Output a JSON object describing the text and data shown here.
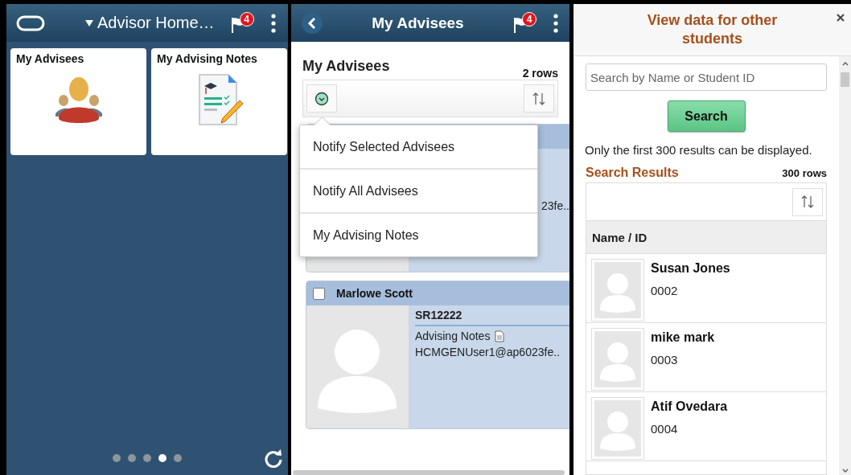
{
  "home_panel": {
    "header": {
      "title": "Advisor Home…",
      "notification_count": "4"
    },
    "tiles": [
      {
        "title": "My Advisees",
        "kind": "people"
      },
      {
        "title": "My Advising Notes",
        "kind": "notes"
      }
    ],
    "pager": [
      {
        "selected": false
      },
      {
        "selected": false
      },
      {
        "selected": false
      },
      {
        "selected": true
      },
      {
        "selected": false
      }
    ]
  },
  "advisees_panel": {
    "header": {
      "title": "My Advisees",
      "notification_count": "4"
    },
    "heading": "My Advisees",
    "row_count": "2 rows",
    "actions_menu": {
      "open": true,
      "items": [
        "Notify Selected Advisees",
        "Notify All Advisees",
        "My Advising Notes"
      ]
    },
    "cards": [
      {
        "kind": "covered",
        "email": "23fe.."
      },
      {
        "kind": "full",
        "name": "Marlowe Scott",
        "checked": false,
        "id": "SR12222",
        "notes_link": "Advising Notes",
        "email": "HCMGENUser1@ap6023fe.."
      }
    ]
  },
  "search_panel": {
    "title": "View data for other students",
    "search": {
      "placeholder": "Search by Name or Student ID"
    },
    "search_button": "Search",
    "notice": "Only the first 300 results can be displayed.",
    "results": {
      "title": "Search Results",
      "row_count": "300 rows",
      "columns": [
        "Name / ID"
      ],
      "rows": [
        {
          "name": "Susan Jones",
          "id": "0002"
        },
        {
          "name": "mike mark",
          "id": "0003"
        },
        {
          "name": "Atif Ovedara",
          "id": "0004"
        }
      ]
    }
  }
}
